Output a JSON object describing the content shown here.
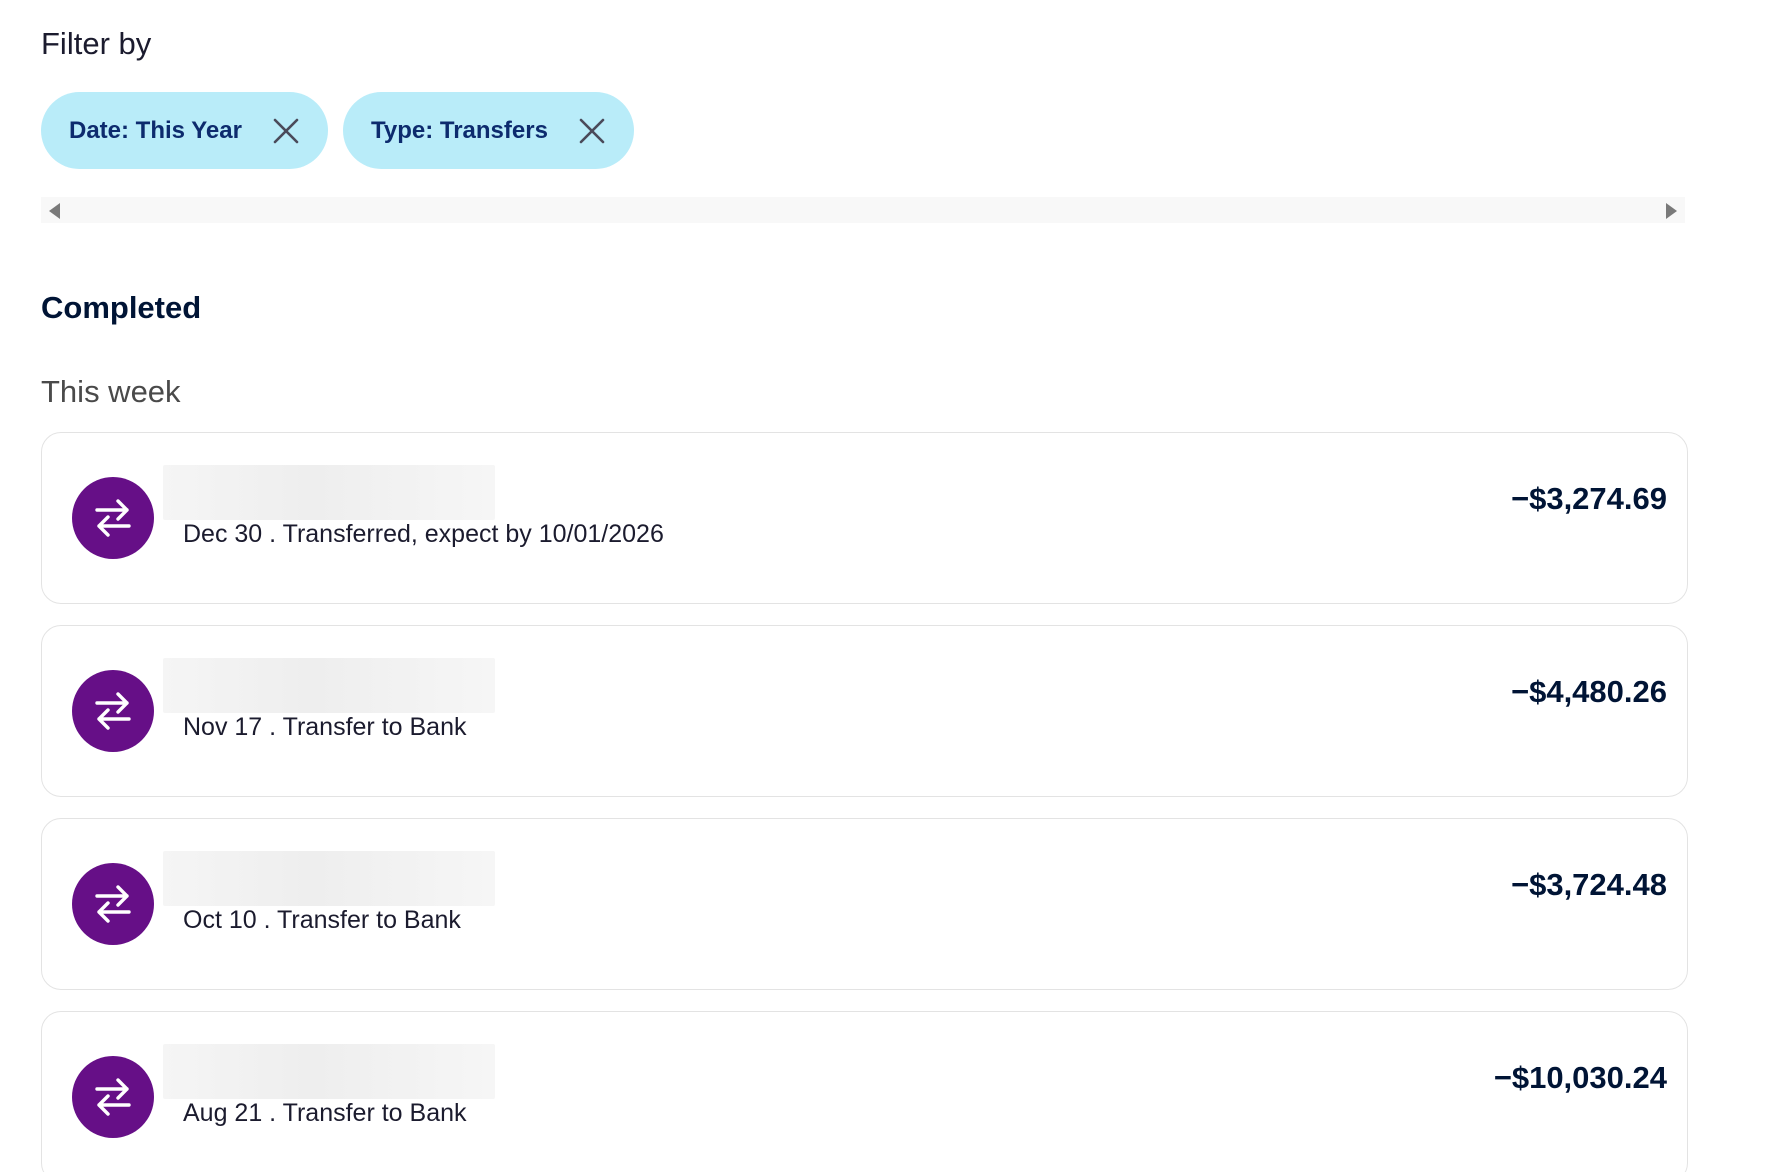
{
  "filter": {
    "title": "Filter by",
    "chips": [
      {
        "label": "Date: This Year",
        "close_icon": "close-icon"
      },
      {
        "label": "Type: Transfers",
        "close_icon": "close-icon"
      }
    ]
  },
  "sections": {
    "completed_title": "Completed",
    "group_title": "This week"
  },
  "transactions": [
    {
      "icon": "transfer-arrows-icon",
      "subtitle": "Dec 30 . Transferred, expect by 10/01/2026",
      "amount": "−$3,274.69"
    },
    {
      "icon": "transfer-arrows-icon",
      "subtitle": "Nov 17 . Transfer to Bank",
      "amount": "−$4,480.26"
    },
    {
      "icon": "transfer-arrows-icon",
      "subtitle": "Oct 10 . Transfer to Bank",
      "amount": "−$3,724.48"
    },
    {
      "icon": "transfer-arrows-icon",
      "subtitle": "Aug 21 . Transfer to Bank",
      "amount": "−$10,030.24"
    }
  ],
  "colors": {
    "chip_bg": "#b9ecf9",
    "chip_text": "#0d2b6e",
    "avatar_bg": "#660f87",
    "text_primary": "#001435"
  }
}
